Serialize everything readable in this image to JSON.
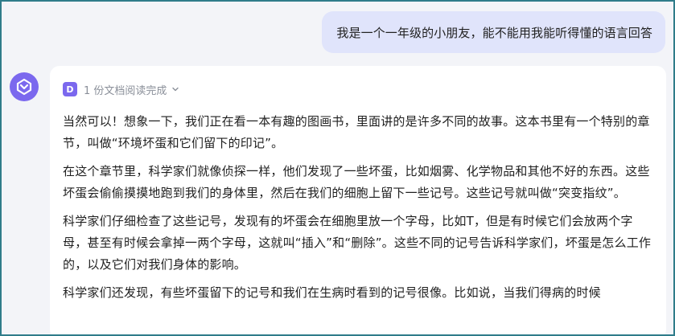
{
  "user_message": {
    "text": "我是一个一年级的小朋友，能不能用我能听得懂的语言回答"
  },
  "assistant": {
    "reference": {
      "icon_letter": "D",
      "label": "1 份文档阅读完成"
    },
    "paragraphs": [
      "当然可以！想象一下，我们正在看一本有趣的图画书，里面讲的是许多不同的故事。这本书里有一个特别的章节，叫做“环境坏蛋和它们留下的印记”。",
      "在这个章节里，科学家们就像侦探一样，他们发现了一些坏蛋，比如烟雾、化学物品和其他不好的东西。这些坏蛋会偷偷摸摸地跑到我们的身体里，然后在我们的细胞上留下一些记号。这些记号就叫做“突变指纹”。",
      "科学家们仔细检查了这些记号，发现有的坏蛋会在细胞里放一个字母，比如T，但是有时候它们会放两个字母，甚至有时候会拿掉一两个字母，这就叫“插入”和“删除”。这些不同的记号告诉科学家们，坏蛋是怎么工作的，以及它们对我们身体的影响。",
      "科学家们还发现，有些坏蛋留下的记号和我们在生病时看到的记号很像。比如说，当我们得病的时候"
    ]
  },
  "colors": {
    "frame_border": "#2f7c8a",
    "background": "#f3f4f8",
    "user_bubble": "#e0e4fb",
    "brand_purple": "#7b68ee"
  }
}
